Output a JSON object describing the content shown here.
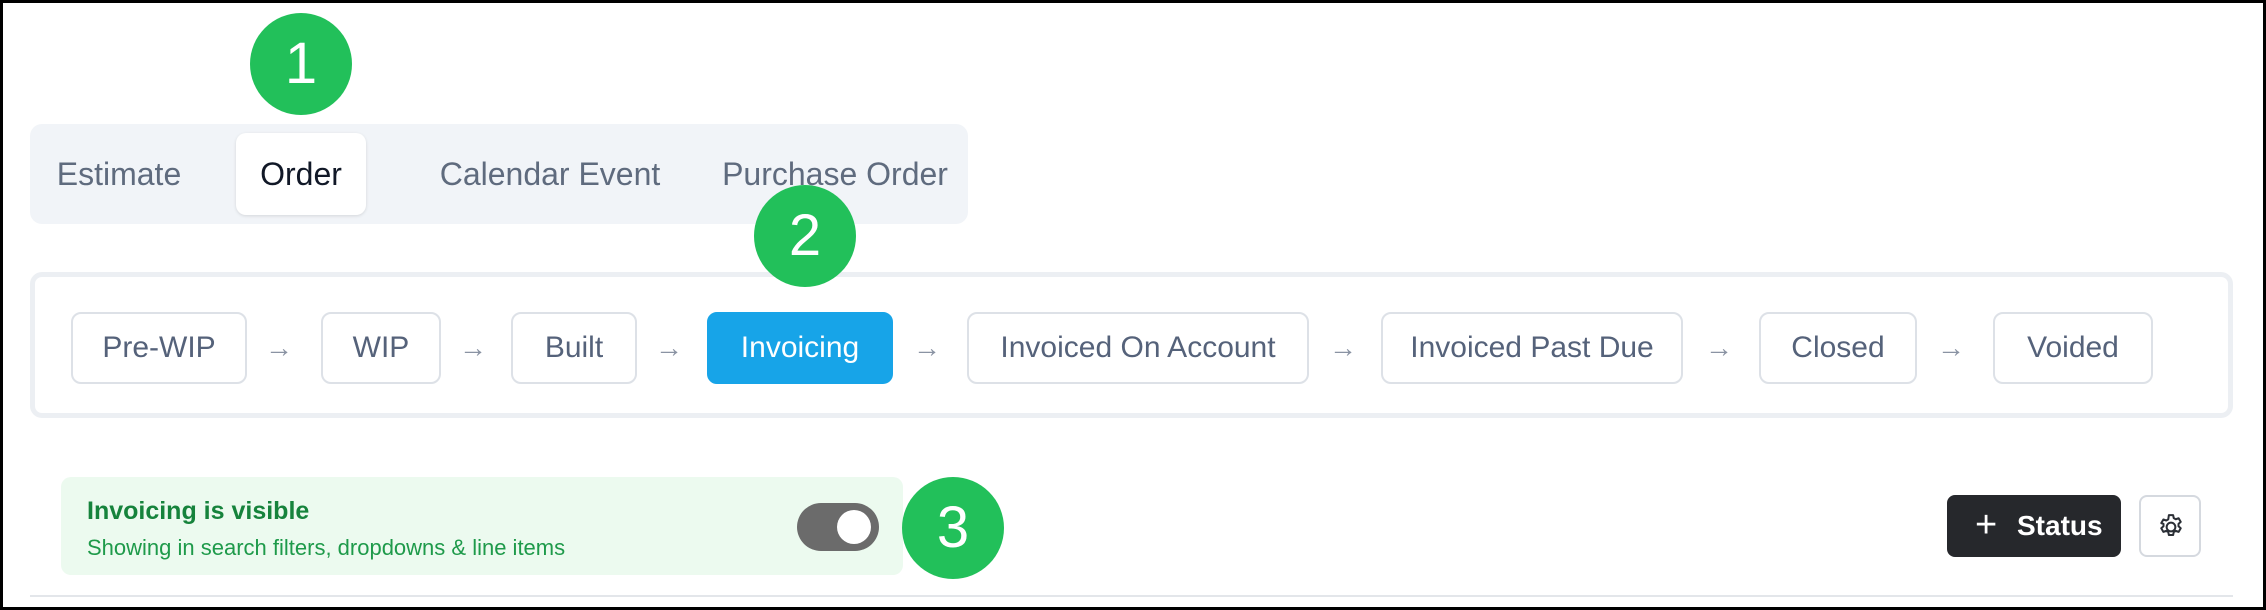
{
  "tabs": [
    "Estimate",
    "Order",
    "Calendar Event",
    "Purchase Order"
  ],
  "active_tab": "Order",
  "markers": [
    "1",
    "2",
    "3"
  ],
  "statuses": [
    "Pre-WIP",
    "WIP",
    "Built",
    "Invoicing",
    "Invoiced On Account",
    "Invoiced Past Due",
    "Closed",
    "Voided"
  ],
  "active_status": "Invoicing",
  "arrow_glyph": "→",
  "visibility": {
    "title": "Invoicing is visible",
    "subtitle": "Showing in search filters, dropdowns & line items",
    "enabled": true
  },
  "actions": {
    "add_icon": "+",
    "add_label": "Status",
    "settings_icon": "gear-icon"
  },
  "colors": {
    "accent": "#17a4e8",
    "marker": "#22c05a",
    "visible_bg": "#ecfaef",
    "visible_text": "#16833c",
    "dark_button": "#26282c"
  }
}
